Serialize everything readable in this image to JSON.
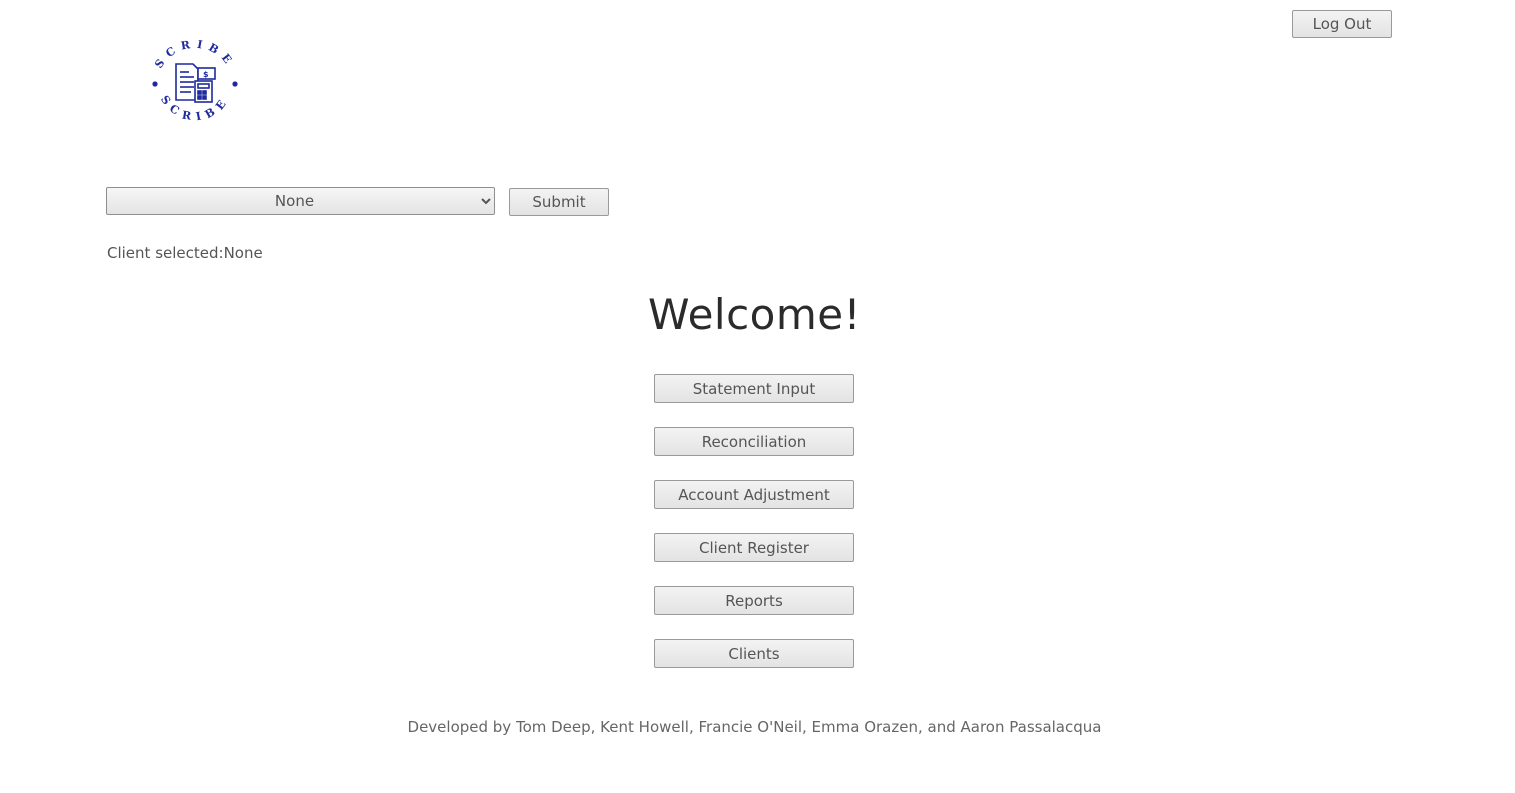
{
  "header": {
    "logout_label": "Log Out",
    "logo_text": "SCRIBE"
  },
  "client_picker": {
    "selected_value": "None",
    "options": [
      "None"
    ],
    "submit_label": "Submit",
    "status_label": "Client selected:",
    "status_value": "None"
  },
  "main": {
    "title": "Welcome!",
    "nav": [
      {
        "label": "Statement Input"
      },
      {
        "label": "Reconciliation"
      },
      {
        "label": "Account Adjustment"
      },
      {
        "label": "Client Register"
      },
      {
        "label": "Reports"
      },
      {
        "label": "Clients"
      }
    ]
  },
  "footer": {
    "credits": "Developed by Tom Deep, Kent Howell, Francie O'Neil, Emma Orazen, and Aaron Passalacqua"
  },
  "colors": {
    "logo": "#1f2a9e",
    "button_bg": "#ececec",
    "text": "#555555"
  },
  "icons": {
    "logo": "scribe-document-calculator-icon"
  }
}
